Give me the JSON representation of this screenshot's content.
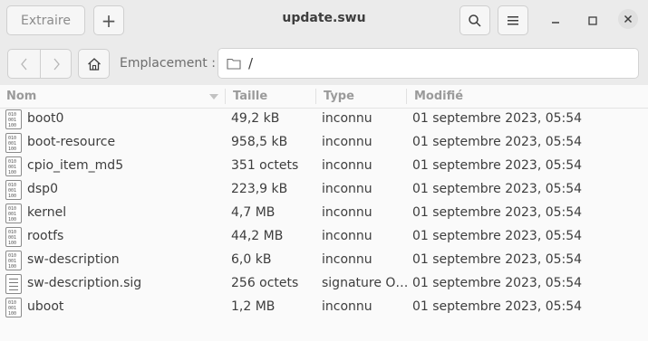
{
  "header": {
    "extract_label": "Extraire",
    "add_label": "+",
    "title": "update.swu",
    "search_icon": "search-icon",
    "menu_icon": "hamburger-menu-icon",
    "minimize_symbol": "–",
    "maximize_symbol": "☐",
    "close_symbol": "✕"
  },
  "location": {
    "label": "Emplacement :",
    "path": "/"
  },
  "columns": {
    "name": "Nom",
    "size": "Taille",
    "type": "Type",
    "modified": "Modifié"
  },
  "files": [
    {
      "name": "boot0",
      "size": "49,2 kB",
      "type": "inconnu",
      "modified": "01 septembre 2023, 05:54",
      "icon": "binary-file-icon"
    },
    {
      "name": "boot-resource",
      "size": "958,5 kB",
      "type": "inconnu",
      "modified": "01 septembre 2023, 05:54",
      "icon": "binary-file-icon"
    },
    {
      "name": "cpio_item_md5",
      "size": "351 octets",
      "type": "inconnu",
      "modified": "01 septembre 2023, 05:54",
      "icon": "binary-file-icon"
    },
    {
      "name": "dsp0",
      "size": "223,9 kB",
      "type": "inconnu",
      "modified": "01 septembre 2023, 05:54",
      "icon": "binary-file-icon"
    },
    {
      "name": "kernel",
      "size": "4,7 MB",
      "type": "inconnu",
      "modified": "01 septembre 2023, 05:54",
      "icon": "binary-file-icon"
    },
    {
      "name": "rootfs",
      "size": "44,2 MB",
      "type": "inconnu",
      "modified": "01 septembre 2023, 05:54",
      "icon": "binary-file-icon"
    },
    {
      "name": "sw-description",
      "size": "6,0 kB",
      "type": "inconnu",
      "modified": "01 septembre 2023, 05:54",
      "icon": "binary-file-icon"
    },
    {
      "name": "sw-description.sig",
      "size": "256 octets",
      "type": "signature O…",
      "modified": "01 septembre 2023, 05:54",
      "icon": "text-file-icon"
    },
    {
      "name": "uboot",
      "size": "1,2 MB",
      "type": "inconnu",
      "modified": "01 septembre 2023, 05:54",
      "icon": "binary-file-icon"
    }
  ]
}
